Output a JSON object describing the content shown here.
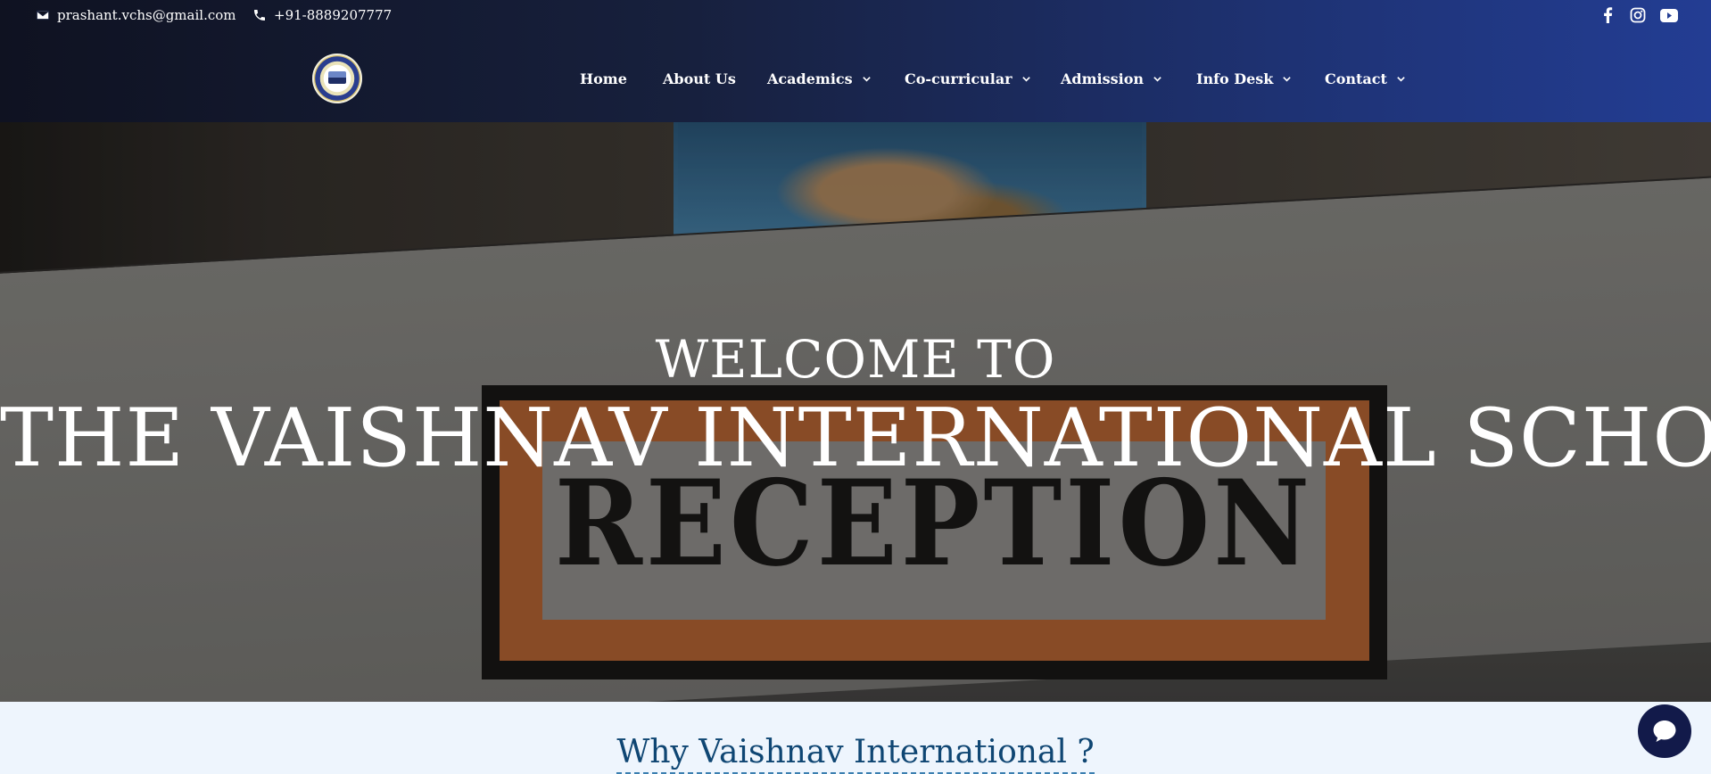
{
  "topbar": {
    "email": "prashant.vchs@gmail.com",
    "phone": "+91-8889207777",
    "social_icons": [
      "facebook-icon",
      "instagram-icon",
      "youtube-icon"
    ]
  },
  "nav": {
    "items": [
      {
        "label": "Home",
        "has_dropdown": false
      },
      {
        "label": "About Us",
        "has_dropdown": false
      },
      {
        "label": "Academics",
        "has_dropdown": true
      },
      {
        "label": "Co-curricular",
        "has_dropdown": true
      },
      {
        "label": "Admission",
        "has_dropdown": true
      },
      {
        "label": "Info Desk",
        "has_dropdown": true
      },
      {
        "label": "Contact",
        "has_dropdown": true
      }
    ]
  },
  "hero": {
    "welcome": "WELCOME TO",
    "school_name": "THE VAISHNAV INTERNATIONAL SCHOOL",
    "background_sign_text": "RECEPTION"
  },
  "why_section": {
    "heading": "Why Vaishnav International ?"
  },
  "colors": {
    "header_start": "#0f1221",
    "header_end": "#233d93",
    "heading_blue": "#0f4673",
    "section_bg": "#eef5fd",
    "chat_button": "#121a4a"
  }
}
